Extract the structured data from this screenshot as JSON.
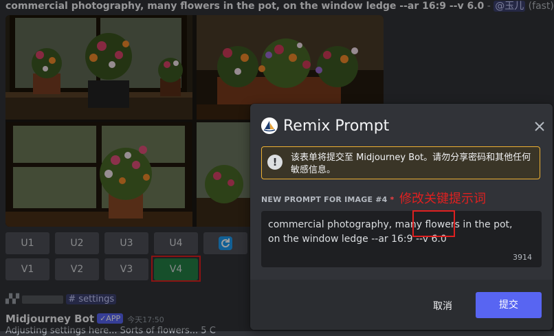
{
  "chat": {
    "prompt_text": "commercial photography, many flowers in the pot, on the window ledge --ar 16:9 --v 6.0",
    "separator": " - ",
    "mention": "@玉儿",
    "speed": "(fast)",
    "upscale_buttons": [
      "U1",
      "U2",
      "U3",
      "U4"
    ],
    "variation_buttons": [
      "V1",
      "V2",
      "V3",
      "V4"
    ],
    "selected_variation": "V4",
    "channel": "# settings",
    "bot_name": "Midjourney Bot",
    "app_badge": "✓APP",
    "timestamp": "今天17:50",
    "last_line": "Adjusting settings here... Sorts of flowers... 5 C"
  },
  "modal": {
    "title": "Remix Prompt",
    "warning": "该表单将提交至 Midjourney Bot。请勿分享密码和其他任何敏感信息。",
    "field_label": "NEW PROMPT FOR IMAGE #4",
    "required_mark": "*",
    "annotation": "修改关键提示词",
    "prompt_value": "commercial photography, many flowers in the pot,\non the window ledge --ar 16:9 --v 6.0",
    "char_count": "3914",
    "cancel_label": "取消",
    "submit_label": "提交"
  },
  "colors": {
    "brand": "#5865f2",
    "selected_button": "#248046",
    "annotation_red": "#e02020",
    "warning_border": "#f0b232"
  },
  "icons": {
    "refresh": "refresh-icon",
    "close": "close-icon",
    "warning": "warning-icon",
    "app_logo": "midjourney-logo-icon"
  }
}
